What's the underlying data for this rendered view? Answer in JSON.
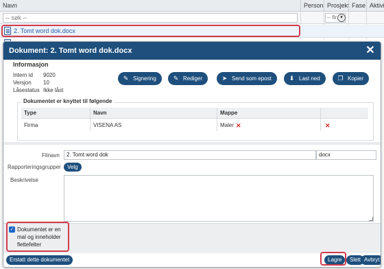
{
  "grid": {
    "columns": [
      "Navn",
      "Person",
      "Prosjekt",
      "Fase",
      "Aktivit"
    ],
    "search_placeholder": "-- søk --",
    "filter_label": "-- fir",
    "row1_label": "2. Tomt word dok.docx"
  },
  "dialog": {
    "title": "Dokument: 2. Tomt word dok.docx",
    "info_title": "Informasjon",
    "info": [
      {
        "key": "Intern id",
        "value": "9020"
      },
      {
        "key": "Versjon",
        "value": "10"
      },
      {
        "key": "Låsestatus",
        "value": "Ikke låst"
      }
    ],
    "actions": [
      "Signering",
      "Rediger",
      "Send som epost",
      "Last ned",
      "Kopier"
    ],
    "links_title": "Dokumentet er knyttet til følgende",
    "links_headers": [
      "Type",
      "Navn",
      "Mappe"
    ],
    "links_rows": [
      {
        "type": "Firma",
        "name": "VISENA AS",
        "folder": "Maler"
      }
    ],
    "filename_label": "Filnavn",
    "filename_value": "2. Tomt word dok",
    "extension_value": "docx",
    "reporting_label": "Rapporteringsgrupper",
    "velg_label": "Velg",
    "description_label": "Beskrivelse",
    "template_checkbox_label": "Dokumentet er en mal og inneholder flettefelter",
    "template_checked": true,
    "replace_button": "Erstatt dette dokumentet",
    "save_button": "Lagre",
    "delete_button": "Slett",
    "cancel_button": "Avbryt",
    "colors": {
      "primary": "#1e4f7d",
      "highlight": "#d23a4a",
      "delete": "#d22a2a"
    }
  }
}
